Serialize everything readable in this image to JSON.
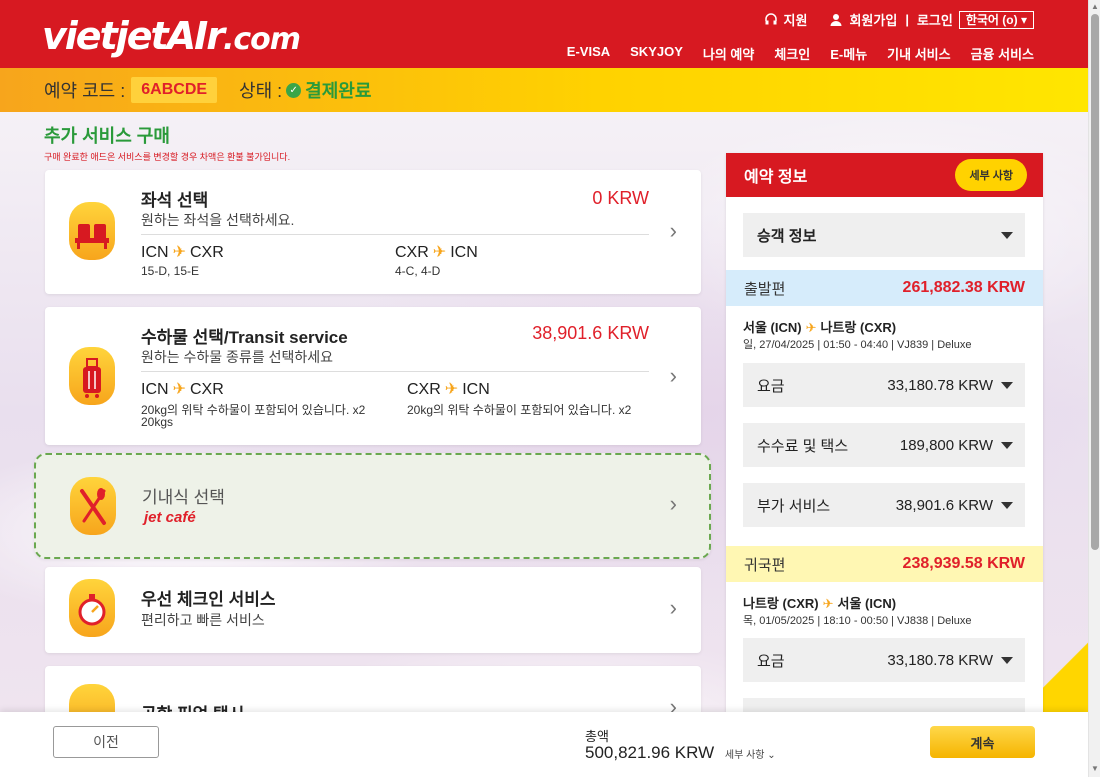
{
  "header": {
    "logo": "vietjetAIr",
    "logo_suffix": ".com",
    "support": "지원",
    "signup": "회원가입",
    "login": "로그인",
    "language": "한국어 (o)",
    "nav": [
      "E-VISA",
      "SKYJOY",
      "나의 예약",
      "체크인",
      "E-메뉴",
      "기내 서비스",
      "금융 서비스"
    ]
  },
  "booking": {
    "code_label": "예약 코드 :",
    "code": "6ABCDE",
    "status_label": "상태 :",
    "status": "결제완료"
  },
  "page": {
    "title": "추가 서비스 구매",
    "note": "구매 완료한 애드온 서비스를 변경할 경우 차액은 환불 불가입니다."
  },
  "cards": {
    "seat": {
      "title": "좌석 선택",
      "subtitle": "원하는 좌석을 선택하세요.",
      "price": "0 KRW",
      "outbound_from": "ICN",
      "outbound_to": "CXR",
      "outbound_detail": "15-D, 15-E",
      "return_from": "CXR",
      "return_to": "ICN",
      "return_detail": "4-C, 4-D"
    },
    "baggage": {
      "title": "수하물 선택/Transit service",
      "subtitle": "원하는 수하물 종류를 선택하세요",
      "price": "38,901.6 KRW",
      "outbound_from": "ICN",
      "outbound_to": "CXR",
      "outbound_detail": "20kg의 위탁 수하물이 포함되어 있습니다. x2",
      "outbound_detail2": "20kgs",
      "return_from": "CXR",
      "return_to": "ICN",
      "return_detail": "20kg의 위탁 수하물이 포함되어 있습니다. x2"
    },
    "meal": {
      "title": "기내식 선택",
      "brand": "jet café"
    },
    "priority": {
      "title": "우선 체크인 서비스",
      "subtitle": "편리하고 빠른 서비스"
    },
    "airport": {
      "title": "공항 픽업 택시"
    }
  },
  "panel": {
    "title": "예약 정보",
    "details_button": "세부 사항",
    "passenger": "승객 정보",
    "outbound": {
      "label": "출발편",
      "amount": "261,882.38 KRW",
      "route_from": "서울 (ICN)",
      "route_to": "나트랑 (CXR)",
      "info": "일, 27/04/2025 | 01:50 - 04:40 | VJ839 | Deluxe",
      "fare_label": "요금",
      "fare": "33,180.78 KRW",
      "tax_label": "수수료 및 택스",
      "tax": "189,800 KRW",
      "addon_label": "부가 서비스",
      "addon": "38,901.6 KRW"
    },
    "return": {
      "label": "귀국편",
      "amount": "238,939.58 KRW",
      "route_from": "나트랑 (CXR)",
      "route_to": "서울 (ICN)",
      "info": "목, 01/05/2025 | 18:10 - 00:50 | VJ838 | Deluxe",
      "fare_label": "요금",
      "fare": "33,180.78 KRW"
    }
  },
  "footer": {
    "prev": "이전",
    "total_label": "총액",
    "total": "500,821.96 KRW",
    "details": "세부 사항",
    "next": "계속"
  },
  "colors": {
    "brand_red": "#d71921",
    "brand_yellow": "#ffd200",
    "success_green": "#2a9a3a"
  }
}
